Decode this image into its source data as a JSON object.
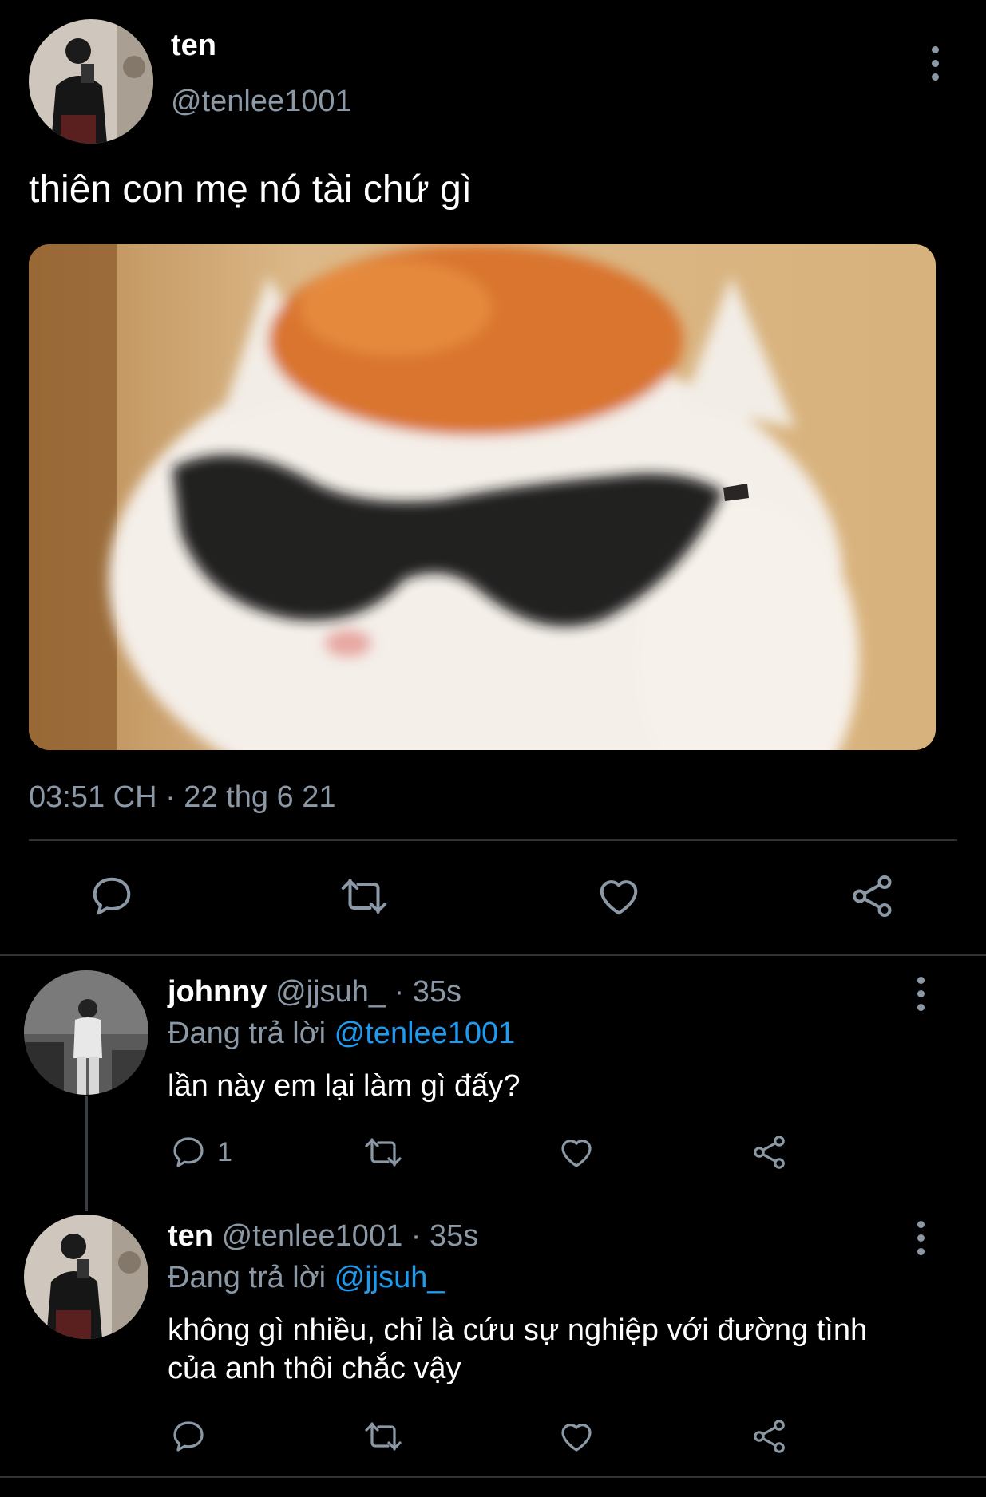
{
  "main_tweet": {
    "author_name": "ten",
    "author_handle": "@tenlee1001",
    "text": "thiên con mẹ nó tài chứ gì",
    "timestamp": "03:51 CH · 22 thg 6 21",
    "media_description": "cat-with-sunglasses-image"
  },
  "replies": [
    {
      "author_name": "johnny",
      "meta": "@jjsuh_ · 35s",
      "replying_prefix": "Đang trả lời",
      "replying_to": "@tenlee1001",
      "text": "lần này em lại làm gì đấy?",
      "reply_count": "1"
    },
    {
      "author_name": "ten",
      "meta": "@tenlee1001 · 35s",
      "replying_prefix": "Đang trả lời",
      "replying_to": "@jjsuh_",
      "text_line1": "không gì nhiều, chỉ là cứu sự nghiệp với đường tình",
      "text_line2": "của anh thôi chắc vậy"
    }
  ],
  "icons": [
    "more-icon",
    "reply-icon",
    "retweet-icon",
    "like-icon",
    "share-icon"
  ],
  "colors": {
    "background": "#000000",
    "text": "#ffffff",
    "muted": "#8b98a5",
    "link": "#1d9bf0",
    "divider": "#2f3336"
  }
}
